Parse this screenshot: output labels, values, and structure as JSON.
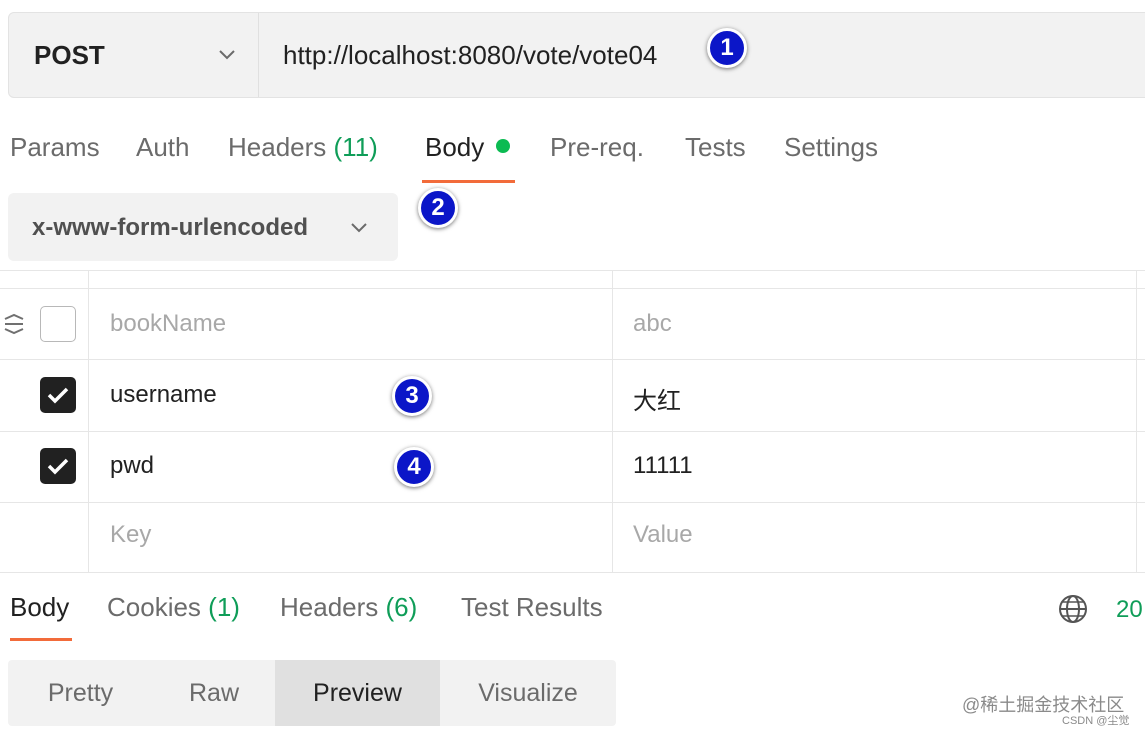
{
  "request": {
    "method": "POST",
    "url": "http://localhost:8080/vote/vote04"
  },
  "annotations": [
    "1",
    "2",
    "3",
    "4"
  ],
  "request_tabs": {
    "params": "Params",
    "auth": "Auth",
    "headers": "Headers",
    "headers_count": "(11)",
    "body": "Body",
    "prereq": "Pre-req.",
    "tests": "Tests",
    "settings": "Settings"
  },
  "body_type": "x-www-form-urlencoded",
  "params": {
    "rows": [
      {
        "key": "bookName",
        "value": "abc",
        "checked": false,
        "disabled": true
      },
      {
        "key": "username",
        "value": "大红",
        "checked": true,
        "disabled": false
      },
      {
        "key": "pwd",
        "value": "11111",
        "checked": true,
        "disabled": false
      }
    ],
    "key_placeholder": "Key",
    "value_placeholder": "Value"
  },
  "response_tabs": {
    "body": "Body",
    "cookies": "Cookies",
    "cookies_count": "(1)",
    "headers": "Headers",
    "headers_count": "(6)",
    "test_results": "Test Results"
  },
  "status_code": "20",
  "view_modes": [
    "Pretty",
    "Raw",
    "Preview",
    "Visualize"
  ],
  "active_view_mode": "Preview",
  "watermark": {
    "main": "@稀土掘金技术社区",
    "sub": "CSDN @尘觉"
  },
  "colors": {
    "accent": "#f26b3a",
    "success": "#0cbb52",
    "badge": "#0b16c8"
  },
  "icons": [
    "chevron-down-icon",
    "drag-handle-icon",
    "checkbox-checked-icon",
    "globe-icon"
  ]
}
